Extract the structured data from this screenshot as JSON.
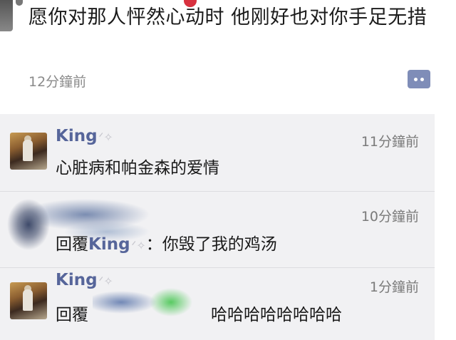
{
  "post": {
    "text": "愿你对那人怦然心动时 他刚好也对你手足无措",
    "time": "12分鐘前"
  },
  "comments": [
    {
      "name": "King",
      "time": "11分鐘前",
      "text": "心脏病和帕金森的爱情"
    },
    {
      "time": "10分鐘前",
      "reply_prefix": "回覆",
      "reply_to": "King",
      "separator": "：",
      "text": "你毁了我的鸡汤"
    },
    {
      "name": "King",
      "time": "1分鐘前",
      "reply_prefix": "回覆",
      "text": "哈哈哈哈哈哈哈哈"
    }
  ]
}
